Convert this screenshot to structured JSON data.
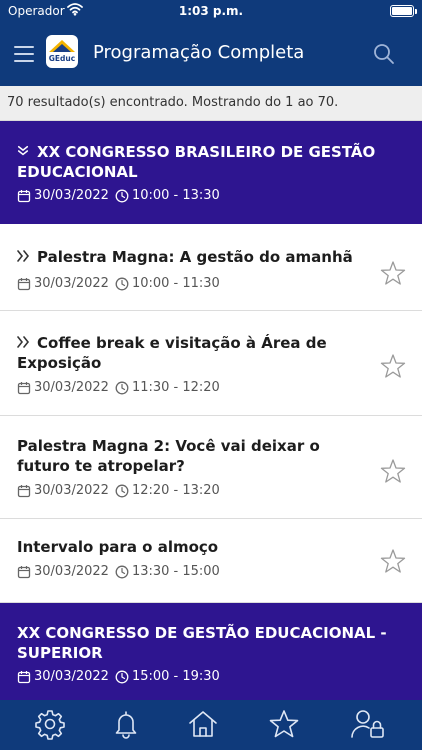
{
  "status_bar": {
    "carrier": "Operador",
    "time": "1:03 p.m."
  },
  "app_bar": {
    "title": "Programação Completa",
    "logo_text": "GEduc"
  },
  "results": {
    "summary": "70 resultado(s) encontrado. Mostrando do 1 ao 70."
  },
  "items": [
    {
      "title": "XX CONGRESSO BRASILEIRO DE GESTÃO EDUCACIONAL",
      "date": "30/03/2022",
      "time": "10:00 - 13:30",
      "kind": "header",
      "expandable": true
    },
    {
      "title": "Palestra Magna: A gestão do amanhã",
      "date": "30/03/2022",
      "time": "10:00 - 11:30",
      "kind": "session",
      "expandable": true,
      "favorited": false
    },
    {
      "title": "Coffee break e visitação à Área de Exposição",
      "date": "30/03/2022",
      "time": "11:30 - 12:20",
      "kind": "session",
      "expandable": true,
      "favorited": false
    },
    {
      "title": "Palestra Magna 2: Você vai deixar o futuro te atropelar?",
      "date": "30/03/2022",
      "time": "12:20 - 13:20",
      "kind": "session",
      "expandable": false,
      "favorited": false
    },
    {
      "title": "Intervalo para o almoço",
      "date": "30/03/2022",
      "time": "13:30 - 15:00",
      "kind": "session",
      "expandable": false,
      "favorited": false
    },
    {
      "title": "XX CONGRESSO DE GESTÃO EDUCACIONAL - SUPERIOR",
      "date": "30/03/2022",
      "time": "15:00 - 19:30",
      "kind": "header",
      "expandable": false
    }
  ],
  "tab_bar": {
    "tabs": [
      "gear-icon",
      "bell-icon",
      "home-icon",
      "star-icon",
      "user-lock-icon"
    ]
  },
  "colors": {
    "primary": "#0f3a7b",
    "header_purple": "#2e1590",
    "text_dark": "#1d1d1d",
    "text_meta": "#555555"
  }
}
